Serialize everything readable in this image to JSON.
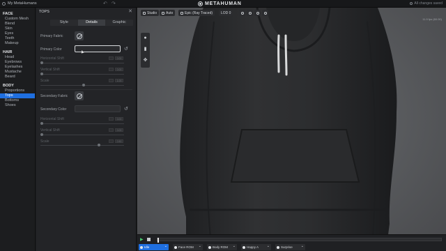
{
  "window": {
    "title": "My MetaHumans",
    "brand": "METAHUMAN",
    "saved_status": "All changes saved"
  },
  "nav": {
    "sections": [
      {
        "label": "FACE",
        "items": [
          "Custom Mesh",
          "Blend",
          "Skin",
          "Eyes",
          "Teeth",
          "Makeup"
        ]
      },
      {
        "label": "HAIR",
        "items": [
          "Head",
          "Eyebrows",
          "Eyelashes",
          "Mustache",
          "Beard"
        ]
      },
      {
        "label": "BODY",
        "items": [
          "Proportions",
          "Tops",
          "Bottoms",
          "Shoes"
        ]
      }
    ],
    "active_item": "Tops"
  },
  "panel": {
    "title": "TOPS",
    "tabs": [
      "Style",
      "Details",
      "Graphic"
    ],
    "active_tab": "Details",
    "primary_fabric_label": "Primary Fabric",
    "primary_color_label": "Primary Color",
    "h_shift_label": "Horizontal Shift",
    "v_shift_label": "Vertical Shift",
    "scale_label": "Scale",
    "secondary_fabric_label": "Secondary Fabric",
    "secondary_color_label": "Secondary Color",
    "h_shift2_label": "Horizontal Shift",
    "v_shift2_label": "Vertical Shift",
    "scale2_label": "Scale",
    "values": {
      "h1": "0.00",
      "v1": "0.00",
      "s1": "1.00",
      "h2": "0.00",
      "v2": "0.00",
      "s2": "0.50"
    }
  },
  "viewport": {
    "toolbar": {
      "studio": "Studio",
      "auto": "Auto",
      "quality": "Epic (Ray Traced)",
      "lod": "LOD 0"
    },
    "fps": "11.9 fps (60.00)"
  },
  "timeline": {
    "animations": [
      "Idle",
      "Face ROM",
      "Body ROM",
      "Happy A",
      "Surprise"
    ],
    "active_animation": "Idle"
  },
  "colors": {
    "accent": "#1f6fe0",
    "play": "#49c46c"
  }
}
